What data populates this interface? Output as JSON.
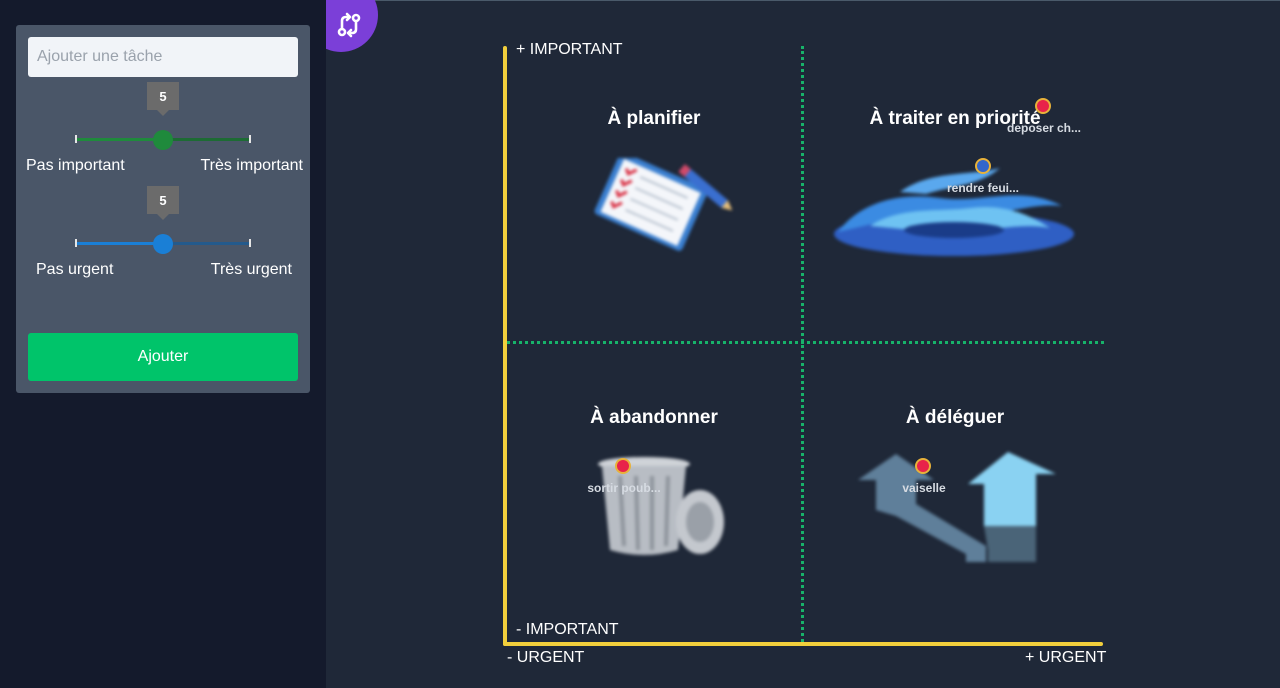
{
  "form": {
    "task_placeholder": "Ajouter une tâche",
    "importance": {
      "value": "5",
      "fraction": 0.5,
      "min_label": "Pas important",
      "max_label": "Très important",
      "color": "#1f8a3c"
    },
    "urgency": {
      "value": "5",
      "fraction": 0.5,
      "min_label": "Pas urgent",
      "max_label": "Très urgent",
      "color": "#1a7fd6"
    },
    "add_label": "Ajouter"
  },
  "badge": {
    "icon": "git-compare-icon",
    "color": "#7b3fd8"
  },
  "matrix": {
    "axis": {
      "y_top": "+ IMPORTANT",
      "y_bottom": "- IMPORTANT",
      "x_left": "- URGENT",
      "x_right": "+ URGENT"
    },
    "quadrants": [
      {
        "id": "plan",
        "title": "À planifier",
        "icon": "clipboard-checklist-icon"
      },
      {
        "id": "priority",
        "title": "À traiter en priorité",
        "icon": "fire-icon"
      },
      {
        "id": "abandon",
        "title": "À abandonner",
        "icon": "trash-can-icon"
      },
      {
        "id": "delegate",
        "title": "À déléguer",
        "icon": "split-arrows-icon"
      }
    ],
    "tasks": [
      {
        "label": "deposer ch...",
        "color": "red"
      },
      {
        "label": "rendre feui...",
        "color": "blue"
      },
      {
        "label": "sortir poub...",
        "color": "red"
      },
      {
        "label": "vaiselle",
        "color": "red"
      }
    ]
  }
}
